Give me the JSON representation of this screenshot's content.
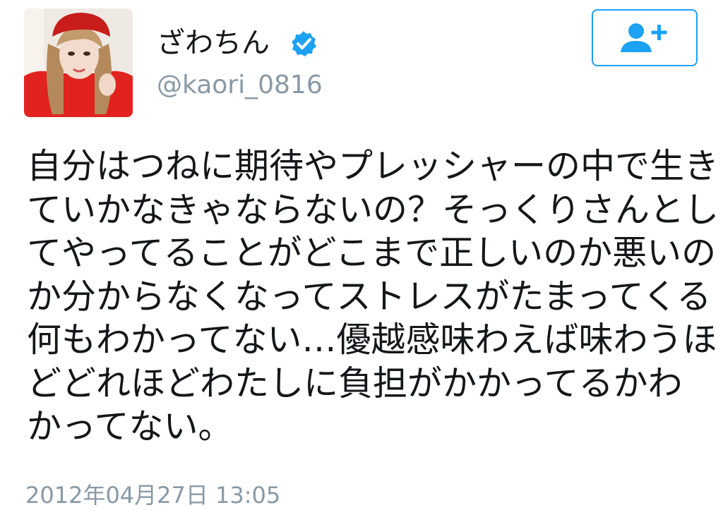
{
  "user": {
    "display_name": "ざわちん",
    "handle": "@kaori_0816",
    "verified_icon": "verified-badge-icon",
    "avatar_icon": "profile-photo"
  },
  "follow_button": {
    "icon": "add-user-icon"
  },
  "tweet": {
    "lines": [
      "自分はつねに期待やプレッシャーの中で生き",
      "ていかなきゃならないの？そっくりさんとし",
      "てやってることがどこまで正しいのか悪いの",
      "か分からなくなってストレスがたまってくる",
      "何もわかってない…優越感味わえば味わうほ",
      "どどれほどわたしに負担がかかってるかわ",
      "かってない。"
    ],
    "timestamp": "2012年04月27日 13:05"
  },
  "colors": {
    "accent": "#1da1f2",
    "secondary_text": "#8899a6",
    "primary_text": "#14171a"
  }
}
